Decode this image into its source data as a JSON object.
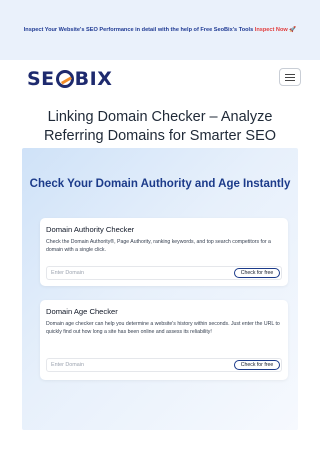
{
  "promo": {
    "text": "Inspect Your Website's SEO Performance in detail with the help of Free SeoBix's Tools",
    "link_label": "Inspect Now 🚀"
  },
  "header": {
    "logo_text_left": "SE",
    "logo_text_right": "BIX"
  },
  "hero": {
    "title": "Linking Domain Checker – Analyze Referring Domains for Smarter SEO"
  },
  "section": {
    "title": "Check Your Domain Authority and Age Instantly"
  },
  "cards": [
    {
      "title": "Domain Authority Checker",
      "description": "Check the Domain Authority®, Page Authority, ranking keywords, and top search competitors for a domain with a single click.",
      "placeholder": "Enter Domain",
      "button_label": "Check for free"
    },
    {
      "title": "Domain Age Checker",
      "description": "Domain age checker can help you determine a website's history within seconds. Just enter the URL to quickly find out how long a site has been online and assess its reliability!",
      "placeholder": "Enter Domain",
      "button_label": "Check for free"
    }
  ],
  "colors": {
    "brand": "#1e2a6e",
    "accent": "#f28c28",
    "promo_link": "#e23b3b",
    "section_title": "#1c3b8a"
  }
}
